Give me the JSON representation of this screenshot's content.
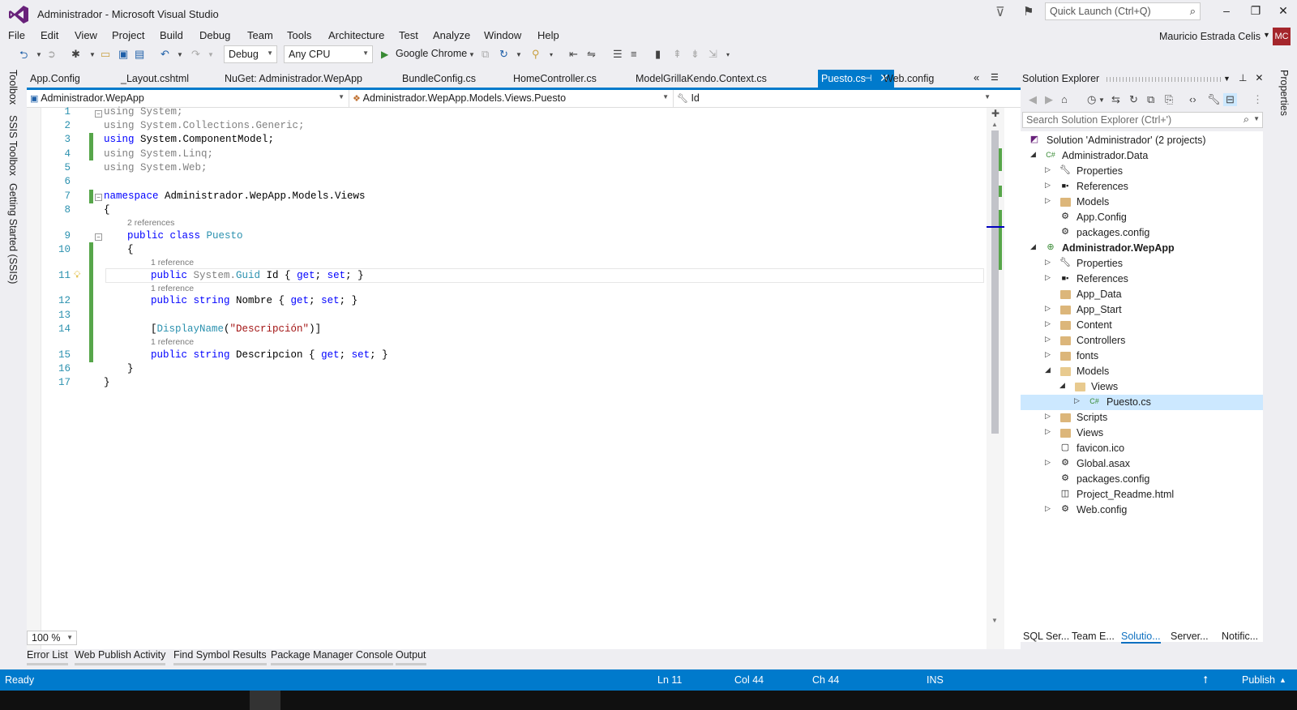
{
  "window": {
    "title": "Administrador - Microsoft Visual Studio",
    "quick_launch_placeholder": "Quick Launch (Ctrl+Q)"
  },
  "menu": [
    "File",
    "Edit",
    "View",
    "Project",
    "Build",
    "Debug",
    "Team",
    "Tools",
    "Architecture",
    "Test",
    "Analyze",
    "Window",
    "Help"
  ],
  "user": {
    "name": "Mauricio Estrada Celis",
    "initials": "MC"
  },
  "toolbar": {
    "configuration": "Debug",
    "platform": "Any CPU",
    "run_target": "Google Chrome"
  },
  "left_tool_windows": [
    "Toolbox",
    "SSIS Toolbox",
    "Getting Started (SSIS)"
  ],
  "doc_tabs": [
    "App.Config",
    "_Layout.cshtml",
    "NuGet: Administrador.WepApp",
    "BundleConfig.cs",
    "HomeController.cs",
    "ModelGrillaKendo.Context.cs",
    "Puesto.cs",
    "Web.config"
  ],
  "active_tab": "Puesto.cs",
  "nav": {
    "project": "Administrador.WepApp",
    "type": "Administrador.WepApp.Models.Views.Puesto",
    "member": "Id"
  },
  "code": {
    "line_numbers": [
      "1",
      "2",
      "3",
      "4",
      "5",
      "6",
      "7",
      "8",
      "9",
      "10",
      "11",
      "12",
      "13",
      "14",
      "15",
      "16",
      "17"
    ],
    "lines": {
      "l1_kw": "using",
      "l1_rest": " System;",
      "l2_kw": "using",
      "l2_rest": " System.Collections.Generic;",
      "l3_kw": "using",
      "l3_rest": " System.ComponentModel;",
      "l4_kw": "using",
      "l4_rest": " System.Linq;",
      "l5_kw": "using",
      "l5_rest": " System.Web;",
      "l7_kw": "namespace",
      "l7_rest": " Administrador.WepApp.Models.Views",
      "open_brace": "{",
      "close_brace": "}",
      "l9_kw": "public class",
      "l9_type": "Puesto",
      "l10": "{",
      "l11_kw": "public",
      "l11_a": " System.",
      "l11_type": "Guid",
      "l11_b": " Id { ",
      "l11_get": "get",
      "l11_c": "; ",
      "l11_set": "set",
      "l11_d": "; }",
      "l12_kw": "public string",
      "l12_a": " Nombre { ",
      "l12_get": "get",
      "l12_c": "; ",
      "l12_set": "set",
      "l12_d": "; }",
      "l14_a": "[",
      "l14_type": "DisplayName",
      "l14_b": "(",
      "l14_str": "\"Descripción\"",
      "l14_c": ")]",
      "l15_kw": "public string",
      "l15_a": " Descripcion { ",
      "l15_get": "get",
      "l15_c": "; ",
      "l15_set": "set",
      "l15_d": "; }",
      "l16": "}"
    },
    "codelens": {
      "class_refs": "2 references",
      "id_refs": "1 reference",
      "nombre_refs": "1 reference",
      "desc_refs": "1 reference"
    }
  },
  "zoom": "100 %",
  "bottom_tabs": [
    "Error List",
    "Web Publish Activity",
    "Find Symbol Results",
    "Package Manager Console",
    "Output"
  ],
  "solution_explorer": {
    "title": "Solution Explorer",
    "search_placeholder": "Search Solution Explorer (Ctrl+')",
    "tree": [
      {
        "label": "Solution 'Administrador' (2 projects)",
        "icon": "solution-icon"
      },
      {
        "label": "Administrador.Data",
        "icon": "csproj-icon"
      },
      {
        "label": "Properties",
        "icon": "wrench-icon"
      },
      {
        "label": "References",
        "icon": "references-icon"
      },
      {
        "label": "Models",
        "icon": "folder-icon"
      },
      {
        "label": "App.Config",
        "icon": "config-icon"
      },
      {
        "label": "packages.config",
        "icon": "config-icon"
      },
      {
        "label": "Administrador.WepApp",
        "icon": "webproj-icon"
      },
      {
        "label": "Properties",
        "icon": "wrench-icon"
      },
      {
        "label": "References",
        "icon": "references-icon"
      },
      {
        "label": "App_Data",
        "icon": "folder-icon"
      },
      {
        "label": "App_Start",
        "icon": "folder-icon"
      },
      {
        "label": "Content",
        "icon": "folder-icon"
      },
      {
        "label": "Controllers",
        "icon": "folder-icon"
      },
      {
        "label": "fonts",
        "icon": "folder-icon"
      },
      {
        "label": "Models",
        "icon": "folder-open-icon"
      },
      {
        "label": "Views",
        "icon": "folder-open-icon"
      },
      {
        "label": "Puesto.cs",
        "icon": "cs-file-icon"
      },
      {
        "label": "Scripts",
        "icon": "folder-icon"
      },
      {
        "label": "Views",
        "icon": "folder-icon"
      },
      {
        "label": "favicon.ico",
        "icon": "image-file-icon"
      },
      {
        "label": "Global.asax",
        "icon": "asax-icon"
      },
      {
        "label": "packages.config",
        "icon": "config-icon"
      },
      {
        "label": "Project_Readme.html",
        "icon": "html-file-icon"
      },
      {
        "label": "Web.config",
        "icon": "config-icon"
      }
    ],
    "bottom_tabs": [
      "SQL Ser...",
      "Team E...",
      "Solutio...",
      "Server...",
      "Notific..."
    ]
  },
  "right_tool_windows": [
    "Properties"
  ],
  "status": {
    "state": "Ready",
    "ln": "Ln 11",
    "col": "Col 44",
    "ch": "Ch 44",
    "mode": "INS",
    "publish": "Publish"
  },
  "colors": {
    "accent": "#007acc",
    "keyword": "#0000ff",
    "type": "#2b91af",
    "string": "#a31515",
    "change_bar": "#57a64a",
    "avatar": "#a4262c"
  }
}
